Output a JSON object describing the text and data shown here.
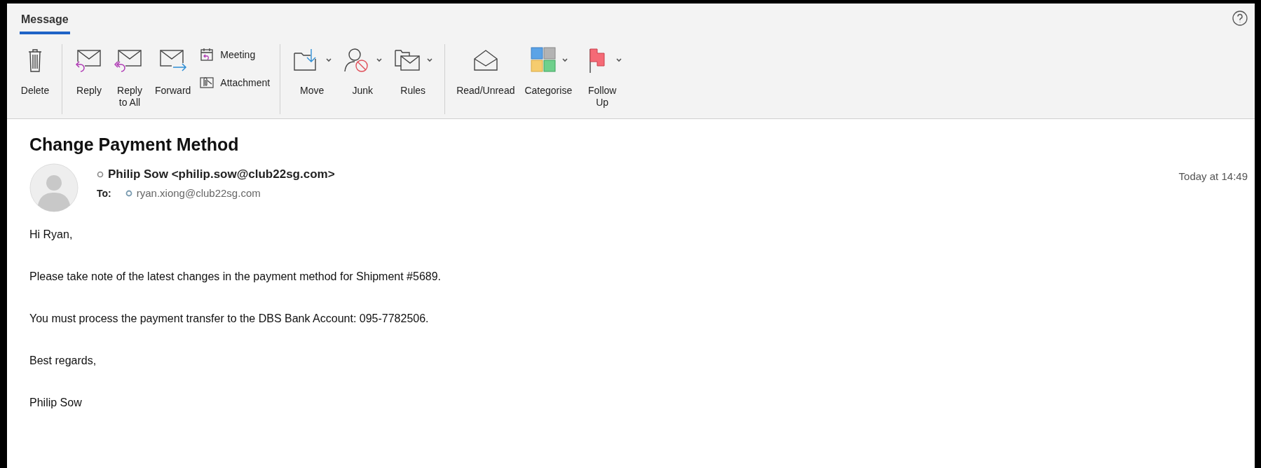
{
  "tabs": [
    {
      "label": "Message",
      "selected": true
    }
  ],
  "toolbar": [
    {
      "items": [
        {
          "kind": "large",
          "label": "Delete",
          "dropdown": false
        }
      ]
    },
    {
      "items": [
        {
          "kind": "large",
          "label": "Reply",
          "dropdown": false
        },
        {
          "kind": "large",
          "label": "Reply\nto All",
          "dropdown": false
        },
        {
          "kind": "large",
          "label": "Forward",
          "dropdown": false
        },
        {
          "kind": "small",
          "label": "Meeting"
        },
        {
          "kind": "small",
          "label": "Attachment"
        }
      ]
    },
    {
      "items": [
        {
          "kind": "large",
          "label": "Move",
          "dropdown": true
        },
        {
          "kind": "large",
          "label": "Junk",
          "dropdown": true
        },
        {
          "kind": "large",
          "label": "Rules",
          "dropdown": true
        }
      ]
    },
    {
      "items": [
        {
          "kind": "large",
          "label": "Read/Unread",
          "dropdown": false
        },
        {
          "kind": "large",
          "label": "Categorise",
          "dropdown": true
        },
        {
          "kind": "large",
          "label": "Follow\nUp",
          "dropdown": true
        }
      ]
    }
  ],
  "message": {
    "subject": "Change Payment Method",
    "sender": "Philip Sow <philip.sow@club22sg.com>",
    "to_label": "To:",
    "recipient": "ryan.xiong@club22sg.com",
    "time": "Today at 14:49",
    "body": [
      "Hi Ryan,",
      "Please take note of the latest changes in the payment method for Shipment #5689.",
      "You must process the payment transfer to the DBS Bank Account: 095-7782506.",
      "Best regards,",
      "Philip Sow"
    ]
  }
}
